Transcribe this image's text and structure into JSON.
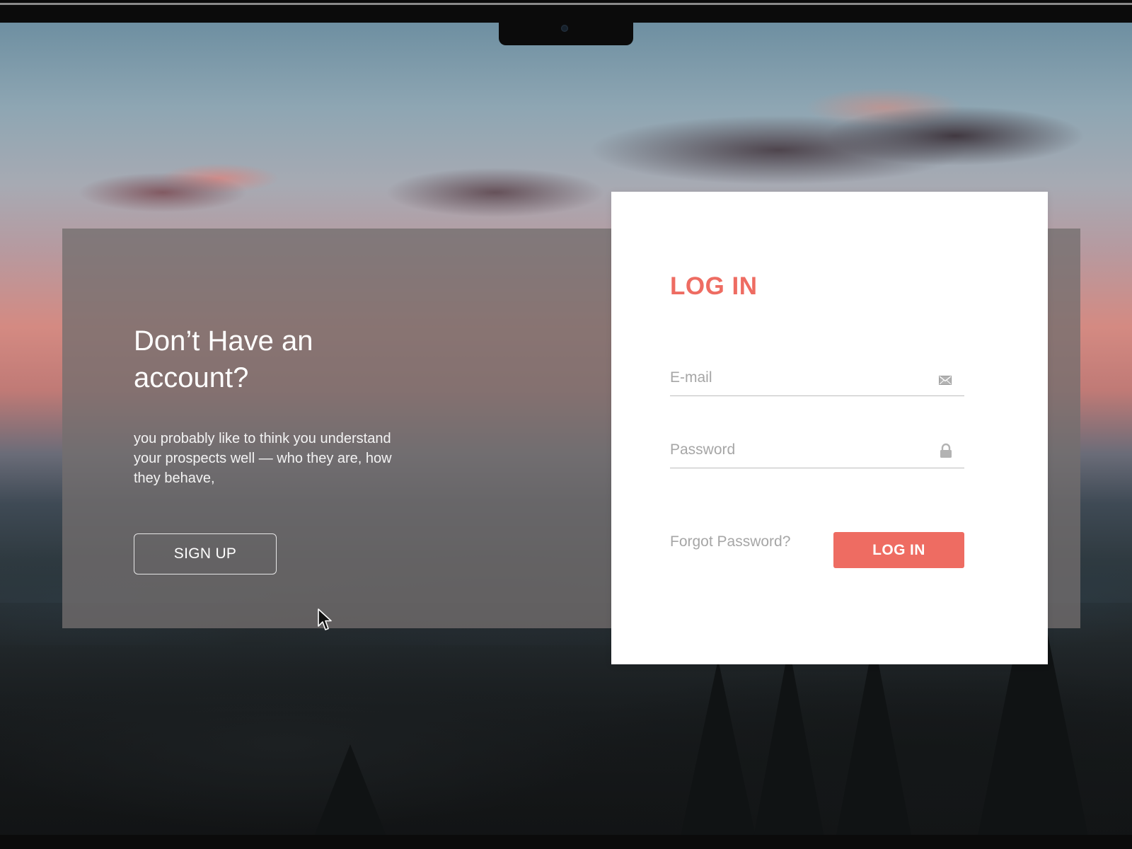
{
  "promo": {
    "title": "Don’t Have an account?",
    "text": "you probably like to think you understand your prospects well — who they are, how they behave,",
    "signup_label": "SIGN UP"
  },
  "login": {
    "title": "LOG IN",
    "email_placeholder": "E-mail",
    "password_placeholder": "Password",
    "forgot_label": "Forgot Password?",
    "submit_label": "LOG IN"
  },
  "icons": {
    "email": "envelope-icon",
    "password": "lock-icon",
    "cursor": "mouse-pointer-icon"
  },
  "colors": {
    "accent": "#ee6c62",
    "card_background": "#ffffff",
    "panel_overlay": "#736e6e",
    "placeholder_text": "#a6a6a6"
  }
}
